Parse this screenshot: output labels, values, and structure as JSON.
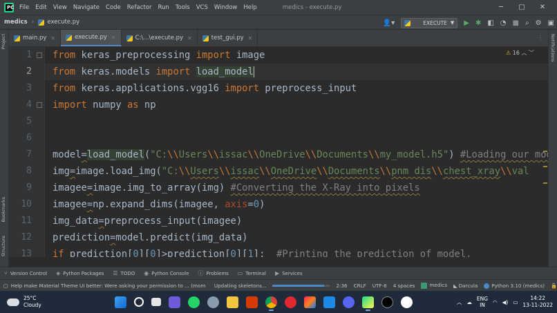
{
  "window": {
    "title": "medics - execute.py",
    "menu": [
      "File",
      "Edit",
      "View",
      "Navigate",
      "Code",
      "Refactor",
      "Run",
      "Tools",
      "VCS",
      "Window",
      "Help"
    ],
    "controls": [
      "─",
      "▢",
      "✕"
    ]
  },
  "navbar": {
    "project": "medics",
    "file": "execute.py",
    "run_config": "EXECUTE"
  },
  "tabs": [
    {
      "label": "main.py",
      "active": false
    },
    {
      "label": "execute.py",
      "active": true
    },
    {
      "label": "C:\\...\\execute.py",
      "active": false
    },
    {
      "label": "test_gui.py",
      "active": false
    }
  ],
  "side_labels": {
    "project": "Project",
    "bookmarks": "Bookmarks",
    "structure": "Structure",
    "notifications": "Notifications"
  },
  "editor": {
    "line_numbers": [
      "1",
      "2",
      "3",
      "4",
      "5",
      "6",
      "7",
      "8",
      "9",
      "10",
      "11",
      "12",
      "13"
    ],
    "current_line": 2,
    "warnings_count": "16"
  },
  "tool_windows": [
    "Version Control",
    "Python Packages",
    "TODO",
    "Python Console",
    "Problems",
    "Terminal",
    "Services"
  ],
  "statusbar": {
    "message": "Help make Material Theme UI better: Were asking your permission to ... (moments ago)",
    "progress_label": "Updating skeletons...",
    "progress": 0.9,
    "position": "2:36",
    "line_sep": "CRLF",
    "encoding": "UTF-8",
    "indent": "4 spaces",
    "project": "medics",
    "theme": "Darcula",
    "interpreter": "Python 3.10 (medics)"
  },
  "taskbar": {
    "temperature": "25°C",
    "weather": "Cloudy",
    "lang_1": "ENG",
    "lang_2": "IN",
    "time": "14:22",
    "date": "13-11-2022"
  }
}
